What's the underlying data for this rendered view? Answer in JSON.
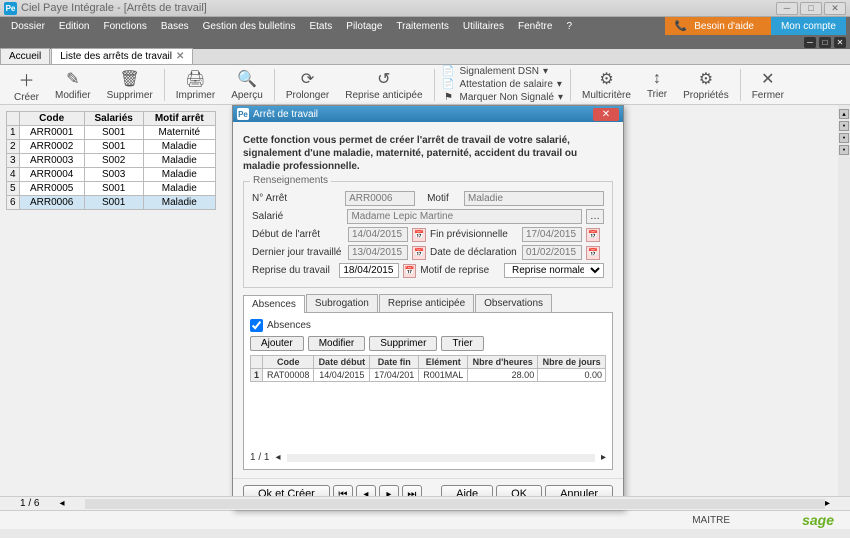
{
  "window": {
    "title": "Ciel Paye Intégrale - [Arrêts de travail]"
  },
  "menu": {
    "items": [
      "Dossier",
      "Edition",
      "Fonctions",
      "Bases",
      "Gestion des bulletins",
      "Etats",
      "Pilotage",
      "Traitements",
      "Utilitaires",
      "Fenêtre",
      "?"
    ],
    "help": "Besoin d'aide",
    "account": "Mon compte"
  },
  "tabs": {
    "home": "Accueil",
    "list": "Liste des arrêts de travail"
  },
  "toolbar": {
    "create": "Créer",
    "modify": "Modifier",
    "delete": "Supprimer",
    "print": "Imprimer",
    "preview": "Aperçu",
    "extend": "Prolonger",
    "early": "Reprise anticipée",
    "dsn": "Signalement DSN",
    "attest": "Attestation de salaire",
    "mark": "Marquer Non Signalé",
    "multi": "Multicritère",
    "sort": "Trier",
    "props": "Propriétés",
    "close": "Fermer"
  },
  "grid": {
    "headers": {
      "code": "Code",
      "emp": "Salariés",
      "motif": "Motif arrêt"
    },
    "rows": [
      {
        "n": "1",
        "code": "ARR0001",
        "emp": "S001",
        "motif": "Maternité"
      },
      {
        "n": "2",
        "code": "ARR0002",
        "emp": "S001",
        "motif": "Maladie"
      },
      {
        "n": "3",
        "code": "ARR0003",
        "emp": "S002",
        "motif": "Maladie"
      },
      {
        "n": "4",
        "code": "ARR0004",
        "emp": "S003",
        "motif": "Maladie"
      },
      {
        "n": "5",
        "code": "ARR0005",
        "emp": "S001",
        "motif": "Maladie"
      },
      {
        "n": "6",
        "code": "ARR0006",
        "emp": "S001",
        "motif": "Maladie"
      }
    ],
    "pager": "1 / 6"
  },
  "dialog": {
    "title": "Arrêt de travail",
    "intro": "Cette fonction vous permet de créer l'arrêt de travail de votre salarié, signalement d'une maladie, maternité, paternité, accident du travail ou maladie professionnelle.",
    "fs_legend": "Renseignements",
    "labels": {
      "num": "N° Arrêt",
      "motif": "Motif",
      "salarie": "Salarié",
      "debut": "Début de l'arrêt",
      "fin": "Fin prévisionnelle",
      "dernier": "Dernier jour travaillé",
      "decl": "Date de déclaration",
      "reprise": "Reprise du travail",
      "motif_reprise": "Motif de reprise"
    },
    "values": {
      "num": "ARR0006",
      "motif": "Maladie",
      "salarie": "Madame Lepic Martine",
      "debut": "14/04/2015",
      "fin": "17/04/2015",
      "dernier": "13/04/2015",
      "decl": "01/02/2015",
      "reprise": "18/04/2015",
      "motif_reprise": "Reprise normale"
    },
    "tabs": {
      "abs": "Absences",
      "sub": "Subrogation",
      "ant": "Reprise anticipée",
      "obs": "Observations"
    },
    "abs": {
      "chk": "Absences",
      "btns": {
        "add": "Ajouter",
        "mod": "Modifier",
        "del": "Supprimer",
        "sort": "Trier"
      },
      "headers": {
        "code": "Code",
        "deb": "Date début",
        "fin": "Date fin",
        "elem": "Elément",
        "h": "Nbre d'heures",
        "j": "Nbre de jours"
      },
      "row": {
        "n": "1",
        "code": "RAT00008",
        "deb": "14/04/2015",
        "fin": "17/04/201",
        "elem": "R001MAL",
        "h": "28.00",
        "j": "0.00"
      },
      "pager": "1 / 1"
    },
    "footer": {
      "okcreate": "Ok et Créer",
      "help": "Aide",
      "ok": "OK",
      "cancel": "Annuler"
    }
  },
  "status": {
    "user": "MAITRE",
    "brand": "sage"
  }
}
